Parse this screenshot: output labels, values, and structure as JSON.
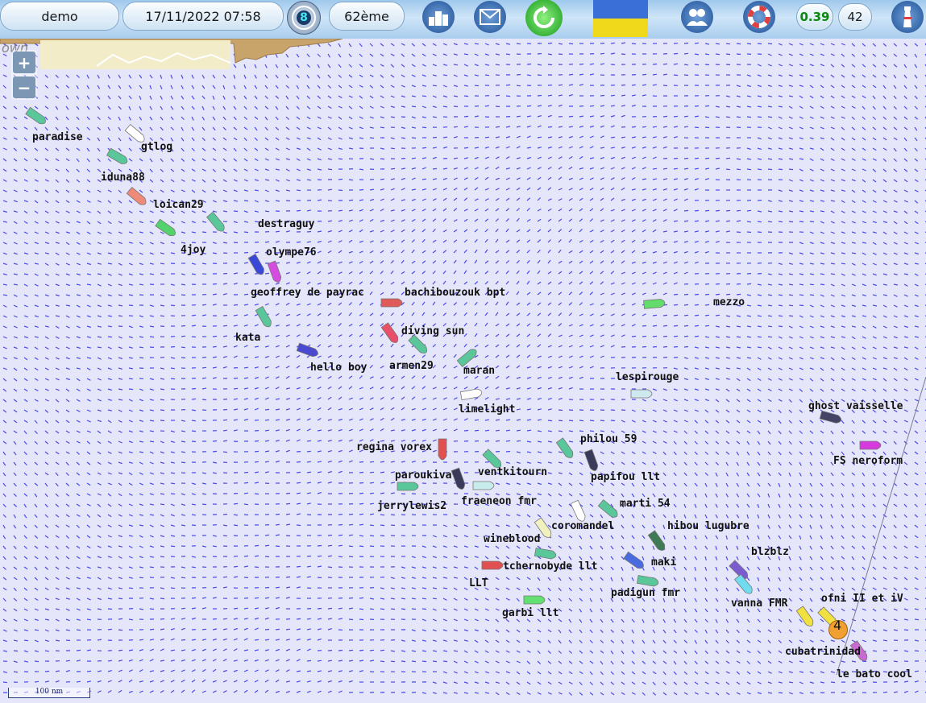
{
  "topbar": {
    "user": "demo",
    "datetime": "17/11/2022 07:58",
    "wind_badge": "8",
    "rank": "62ème",
    "stat_1": "0.39",
    "stat_2": "42",
    "icons": [
      "compass-icon",
      "podium-icon",
      "mail-icon",
      "refresh-icon",
      "flag-icon",
      "team-icon",
      "lifebuoy-icon",
      "lighthouse-icon"
    ],
    "flag_colors": [
      "#3a6fd8",
      "#f0d81a"
    ]
  },
  "map": {
    "coast_text": "own",
    "scale_label": "100 nm",
    "zoom_in": "+",
    "zoom_out": "−",
    "marker_number": "4"
  },
  "boats": [
    {
      "name": "paradise",
      "color": "#5ac79a"
    },
    {
      "name": "gtlog",
      "color": "#ffffff"
    },
    {
      "name": "iduna88",
      "color": "#5ac79a"
    },
    {
      "name": "loican29",
      "color": "#f08a78"
    },
    {
      "name": "destraguy",
      "color": "#5ac79a"
    },
    {
      "name": "4joy",
      "color": "#53d36b"
    },
    {
      "name": "olympe76",
      "color": "#d44de0"
    },
    {
      "name": "geoffrey de payrac",
      "color": "#3a48d8"
    },
    {
      "name": "bachibouzouk bpt",
      "color": "#e05a5a"
    },
    {
      "name": "mezzo",
      "color": "#62dc6a"
    },
    {
      "name": "kata",
      "color": "#5ac79a"
    },
    {
      "name": "diving sun",
      "color": "#e8506a"
    },
    {
      "name": "armen29",
      "color": "#5ac79a"
    },
    {
      "name": "hello boy",
      "color": "#4a4ad0"
    },
    {
      "name": "maran",
      "color": "#5ac79a"
    },
    {
      "name": "lespirouge",
      "color": "#cde8ee"
    },
    {
      "name": "limelight",
      "color": "#ffffff"
    },
    {
      "name": "ghost vaisselle",
      "color": "#444466"
    },
    {
      "name": "FS neroform",
      "color": "#d43adc"
    },
    {
      "name": "philou 59",
      "color": "#5ac79a"
    },
    {
      "name": "regina vorex",
      "color": "#e05050"
    },
    {
      "name": "ventkitourn",
      "color": "#5ac79a"
    },
    {
      "name": "papifou llt",
      "color": "#3a3a5a"
    },
    {
      "name": "paroukiva",
      "color": "#3a3a5a"
    },
    {
      "name": "fraeneon fmr",
      "color": "#c8ecec"
    },
    {
      "name": "jerrylewis2",
      "color": "#5ac79a"
    },
    {
      "name": "marti 54",
      "color": "#5ac79a"
    },
    {
      "name": "coromandel",
      "color": "#ffffff"
    },
    {
      "name": "hibou lugubre",
      "color": "#3d7a55"
    },
    {
      "name": "wineblood",
      "color": "#f0f0c0"
    },
    {
      "name": "blzblz",
      "color": "#7b5cd0"
    },
    {
      "name": "tchernobyde llt",
      "color": "#5ac79a"
    },
    {
      "name": "maki",
      "color": "#4a6ae0"
    },
    {
      "name": "LLT",
      "color": "#e05050"
    },
    {
      "name": "padigun fmr",
      "color": "#5ac79a"
    },
    {
      "name": "vanna FMR",
      "color": "#6fdcf0"
    },
    {
      "name": "garbi llt",
      "color": "#62e072"
    },
    {
      "name": "ofni II et iV",
      "color": "#f0e040"
    },
    {
      "name": "cubatrinidad",
      "color": "#f0e040"
    },
    {
      "name": "le bato cool",
      "color": "#c86ad0"
    }
  ]
}
